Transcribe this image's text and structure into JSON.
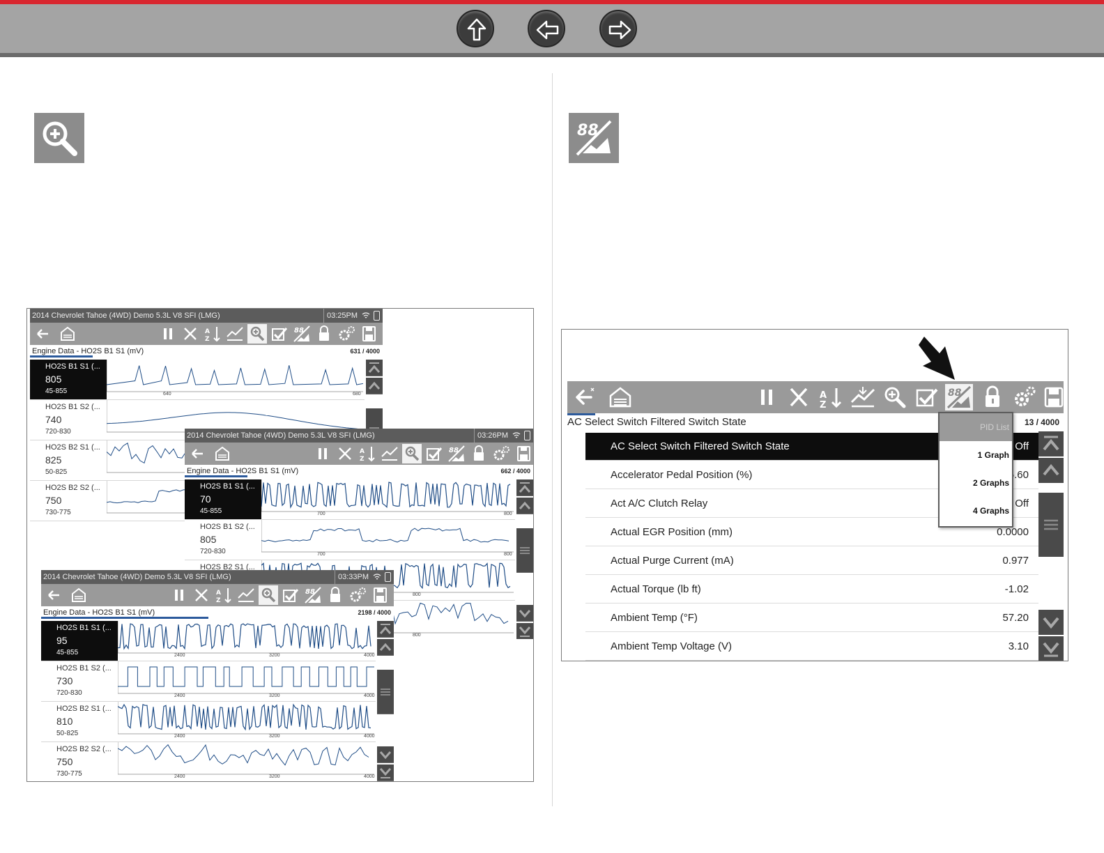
{
  "nav": {
    "buttons": [
      {
        "name": "up-arrow-icon"
      },
      {
        "name": "back-arrow-icon"
      },
      {
        "name": "forward-arrow-icon"
      }
    ]
  },
  "left_icon": "zoom-in-icon",
  "right_icon": "graph-view-icon",
  "screens": [
    {
      "title": "2014 Chevrolet Tahoe (4WD) Demo 5.3L V8 SFI (LMG)",
      "time": "03:25PM",
      "header": "Engine Data - HO2S B1 S1 (mV)",
      "count": "631 / 4000",
      "rows": [
        {
          "name": "HO2S B1 S1 (...",
          "value": "805",
          "range": "45-855",
          "ticks": [
            "640",
            "680"
          ]
        },
        {
          "name": "HO2S B1 S2 (...",
          "value": "740",
          "range": "720-830",
          "ticks": []
        },
        {
          "name": "HO2S B2 S1 (...",
          "value": "825",
          "range": "50-825",
          "ticks": []
        },
        {
          "name": "HO2S B2 S2 (...",
          "value": "750",
          "range": "730-775",
          "ticks": []
        }
      ]
    },
    {
      "title": "2014 Chevrolet Tahoe (4WD) Demo 5.3L V8 SFI (LMG)",
      "time": "03:26PM",
      "header": "Engine Data - HO2S B1 S1 (mV)",
      "count": "662 / 4000",
      "rows": [
        {
          "name": "HO2S B1 S1 (...",
          "value": "70",
          "range": "45-855",
          "ticks": [
            "700",
            "800"
          ]
        },
        {
          "name": "HO2S B1 S2 (...",
          "value": "805",
          "range": "720-830",
          "ticks": [
            "700",
            "800"
          ]
        },
        {
          "name": "HO2S B2 S1 (...",
          "value": "",
          "range": "",
          "ticks": [
            "800"
          ]
        },
        {
          "name": "",
          "value": "",
          "range": "",
          "ticks": [
            "800"
          ]
        }
      ]
    },
    {
      "title": "2014 Chevrolet Tahoe (4WD) Demo 5.3L V8 SFI (LMG)",
      "time": "03:33PM",
      "header": "Engine Data - HO2S B1 S1 (mV)",
      "count": "2198 / 4000",
      "rows": [
        {
          "name": "HO2S B1 S1 (...",
          "value": "95",
          "range": "45-855",
          "ticks": [
            "2400",
            "3200",
            "4000"
          ]
        },
        {
          "name": "HO2S B1 S2 (...",
          "value": "730",
          "range": "720-830",
          "ticks": [
            "2400",
            "3200",
            "4000"
          ]
        },
        {
          "name": "HO2S B2 S1 (...",
          "value": "810",
          "range": "50-825",
          "ticks": [
            "2400",
            "3200",
            "4000"
          ]
        },
        {
          "name": "HO2S B2 S2 (...",
          "value": "750",
          "range": "730-775",
          "ticks": [
            "2400",
            "3200",
            "4000"
          ]
        }
      ]
    }
  ],
  "pid_screen": {
    "header": "AC Select Switch Filtered Switch State",
    "count": "13 / 4000",
    "rows": [
      {
        "name": "AC Select Switch Filtered Switch State",
        "value": "Off",
        "selected": true
      },
      {
        "name": "Accelerator Pedal Position (%)",
        "value": "5.60",
        "selected": false
      },
      {
        "name": "Act A/C Clutch Relay",
        "value": "Off",
        "selected": false
      },
      {
        "name": "Actual EGR Position (mm)",
        "value": "0.0000",
        "selected": false
      },
      {
        "name": "Actual Purge Current (mA)",
        "value": "0.977",
        "selected": false
      },
      {
        "name": "Actual Torque (lb ft)",
        "value": "-1.02",
        "selected": false
      },
      {
        "name": "Ambient Temp (°F)",
        "value": "57.20",
        "selected": false
      },
      {
        "name": "Ambient Temp Voltage (V)",
        "value": "3.10",
        "selected": false
      }
    ],
    "dropdown": [
      "PID List",
      "1 Graph",
      "2 Graphs",
      "4 Graphs"
    ]
  },
  "colors": {
    "accent_red": "#d8262f",
    "toolbar_gray": "#9a9a9a",
    "selected_bg": "#0d0d0d",
    "trace_blue": "#1e4c86"
  }
}
